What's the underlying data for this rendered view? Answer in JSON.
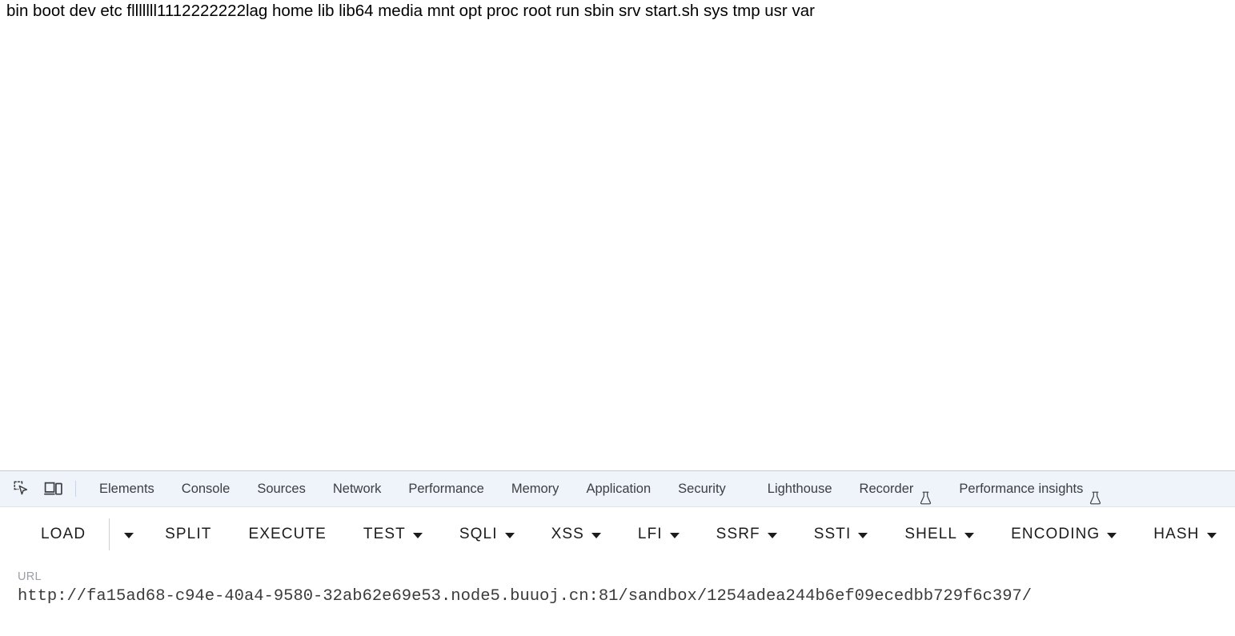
{
  "page": {
    "body_text": "bin boot dev etc flllllll1112222222lag home lib lib64 media mnt opt proc root run sbin srv start.sh sys tmp usr var"
  },
  "devtools": {
    "icons": {
      "inspect": "inspect-element-icon",
      "device": "device-toolbar-icon"
    },
    "tabs": [
      {
        "label": "Elements",
        "experimental": false
      },
      {
        "label": "Console",
        "experimental": false
      },
      {
        "label": "Sources",
        "experimental": false
      },
      {
        "label": "Network",
        "experimental": false
      },
      {
        "label": "Performance",
        "experimental": false
      },
      {
        "label": "Memory",
        "experimental": false
      },
      {
        "label": "Application",
        "experimental": false
      },
      {
        "label": "Security",
        "experimental": false
      },
      {
        "label": "Lighthouse",
        "experimental": false
      },
      {
        "label": "Recorder",
        "experimental": true
      },
      {
        "label": "Performance insights",
        "experimental": true
      }
    ]
  },
  "toolbar": {
    "buttons": [
      {
        "label": "LOAD",
        "split_caret": true,
        "caret": false
      },
      {
        "label": "SPLIT",
        "split_caret": false,
        "caret": false
      },
      {
        "label": "EXECUTE",
        "split_caret": false,
        "caret": false
      },
      {
        "label": "TEST",
        "split_caret": false,
        "caret": true
      },
      {
        "label": "SQLI",
        "split_caret": false,
        "caret": true
      },
      {
        "label": "XSS",
        "split_caret": false,
        "caret": true
      },
      {
        "label": "LFI",
        "split_caret": false,
        "caret": true
      },
      {
        "label": "SSRF",
        "split_caret": false,
        "caret": true
      },
      {
        "label": "SSTI",
        "split_caret": false,
        "caret": true
      },
      {
        "label": "SHELL",
        "split_caret": false,
        "caret": true
      },
      {
        "label": "ENCODING",
        "split_caret": false,
        "caret": true
      },
      {
        "label": "HASH",
        "split_caret": false,
        "caret": true
      }
    ]
  },
  "url": {
    "label": "URL",
    "value": "http://fa15ad68-c94e-40a4-9580-32ab62e69e53.node5.buuoj.cn:81/sandbox/1254adea244b6ef09ecedbb729f6c397/"
  },
  "colors": {
    "tabbar_bg": "#eff3fa",
    "tab_text": "#3c4043",
    "toolbar_text": "#1c1c1c",
    "url_label": "#9aa0a6",
    "url_value": "#3b3b3b",
    "page_bg": "#ffffff",
    "divider": "#cfcfcf"
  }
}
